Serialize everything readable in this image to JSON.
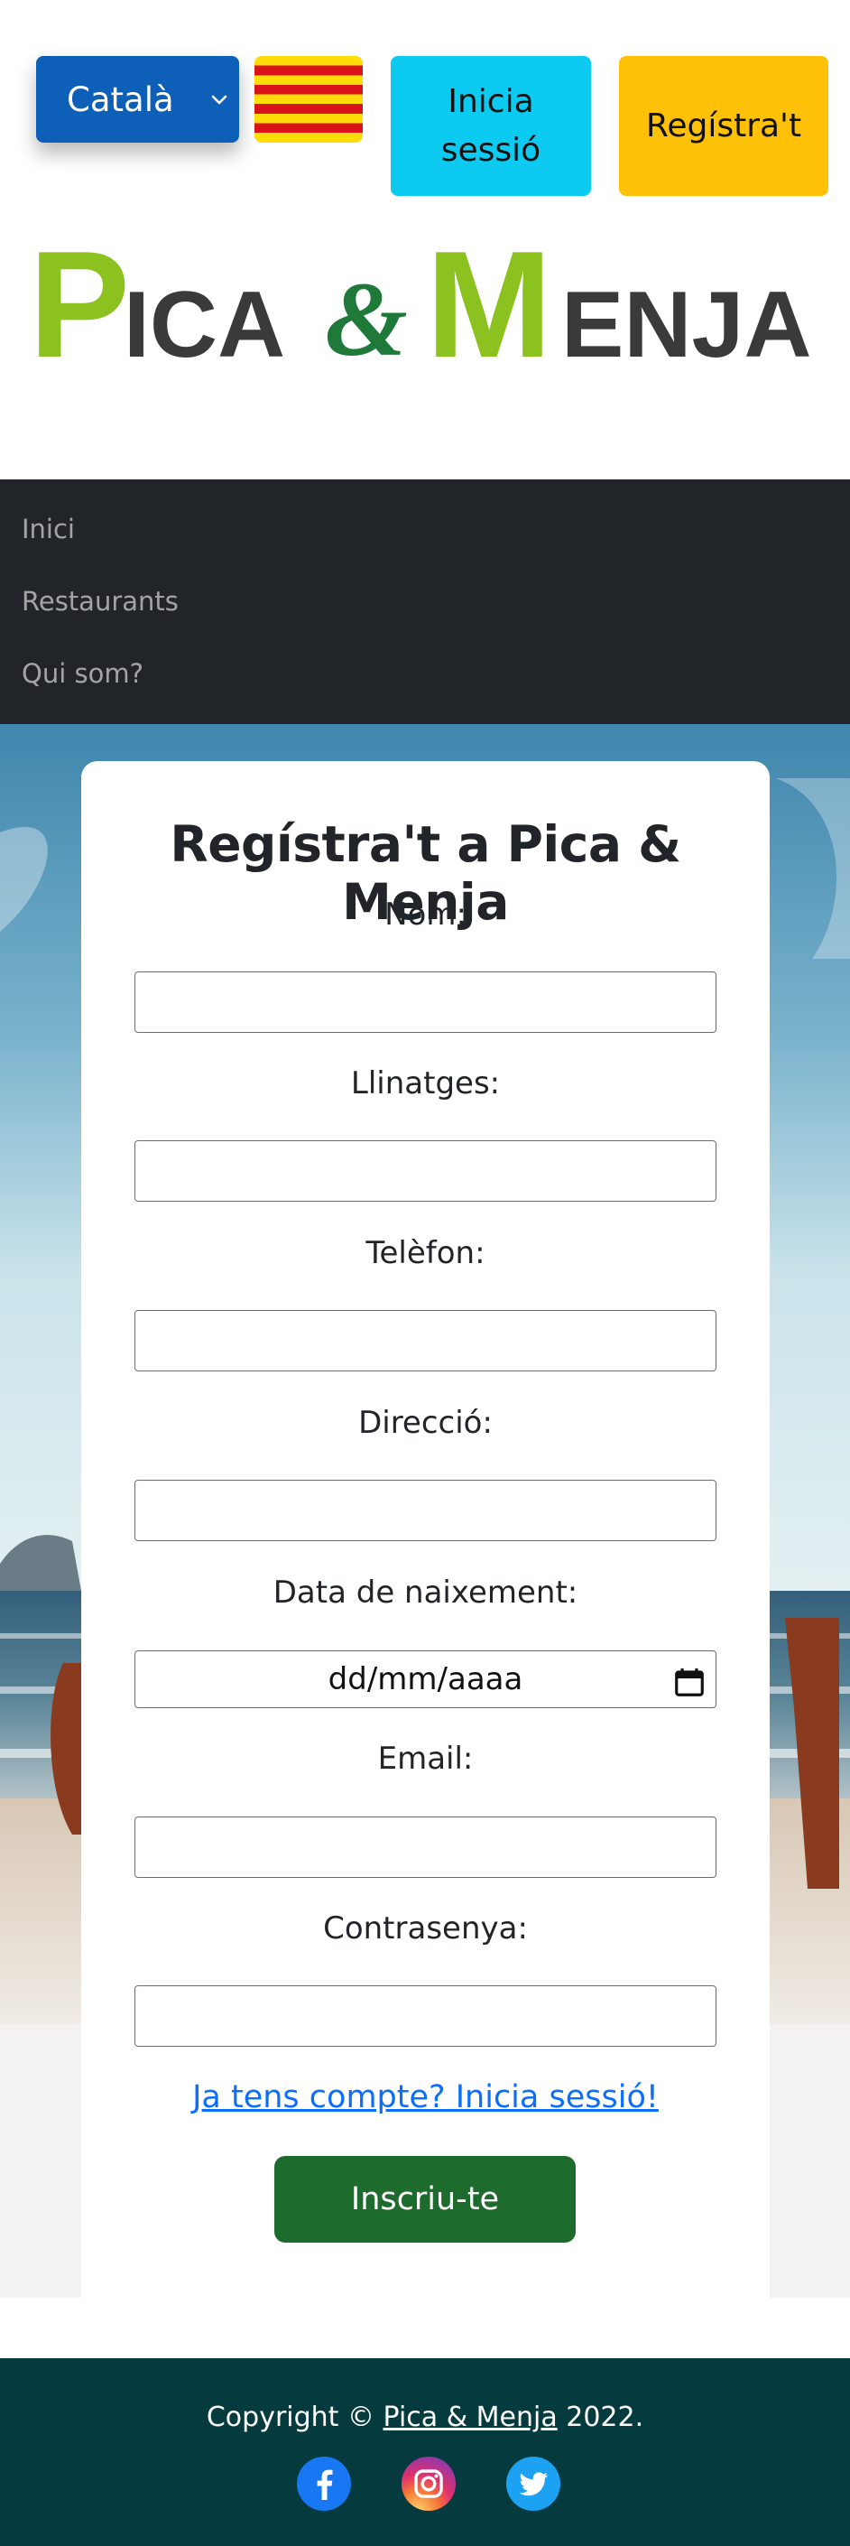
{
  "header": {
    "language": "Català",
    "login_button": "Inicia sessió",
    "register_button": "Regístra't"
  },
  "logo": {
    "text": "Pica & Menja",
    "colors": {
      "green": "#8cc21f",
      "dark_green": "#1f7a3a",
      "gray": "#3a3a3a"
    }
  },
  "nav": {
    "items": [
      "Inici",
      "Restaurants",
      "Qui som?"
    ]
  },
  "form": {
    "title": "Regístra't a Pica & Menja",
    "fields": [
      {
        "label": "Nom:",
        "value": ""
      },
      {
        "label": "Llinatges:",
        "value": ""
      },
      {
        "label": "Telèfon:",
        "value": ""
      },
      {
        "label": "Direcció:",
        "value": ""
      },
      {
        "label": "Data de naixement:",
        "value": "dd/mm/aaaa"
      },
      {
        "label": "Email:",
        "value": ""
      },
      {
        "label": "Contrasenya:",
        "value": ""
      }
    ],
    "login_link": "Ja tens compte? Inicia sessió!",
    "submit_button": "Inscriu-te"
  },
  "footer": {
    "copyright_prefix": "Copyright ©",
    "site_link": "Pica & Menja",
    "year": "2022.",
    "social": [
      "facebook-icon",
      "instagram-icon",
      "twitter-icon"
    ]
  },
  "colors": {
    "nav_bg": "#212529",
    "footer_bg": "#053b3e",
    "language_select": "#0d5fb8",
    "login_button": "#0dcaf0",
    "register_button": "#ffc107",
    "submit_button": "#1e6b2e",
    "link": "#0d6efd"
  }
}
